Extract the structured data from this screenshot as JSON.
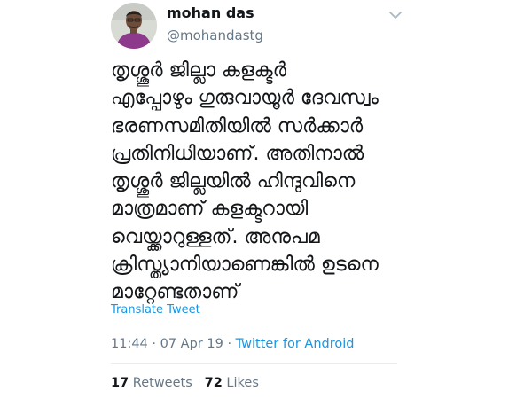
{
  "author": {
    "name": "mohan das",
    "handle": "@mohandastg"
  },
  "tweet": {
    "lines": [
      "തൃശ്ശൂർ ജില്ലാ കളക്ടർ",
      "എപ്പോഴും ഗുരുവായൂർ ദേവസ്വം",
      "ഭരണസമിതിയിൽ സർക്കാർ",
      "പ്രതിനിധിയാണ്. അതിനാൽ",
      "തൃശ്ശൂർ ജില്ലയിൽ ഹിന്ദുവിനെ",
      "മാത്രമാണ് കളക്ടറായി",
      "വെയ്ക്കാറുള്ളത്. അനുപമ",
      "ക്രിസ്ത്യാനിയാണെങ്കിൽ ഉടനെ",
      "മാറ്റേണ്ടതാണ്"
    ],
    "translate_label": "Translate Tweet"
  },
  "meta": {
    "time": "11:44",
    "separator": " · ",
    "date": "07 Apr 19",
    "source": "Twitter for Android"
  },
  "stats": {
    "retweets_count": "17",
    "retweets_label": "Retweets",
    "likes_count": "72",
    "likes_label": "Likes"
  },
  "icons": {
    "caret": "chevron-down-icon"
  },
  "colors": {
    "link": "#1b95e0",
    "secondary_text": "#657786",
    "divider": "#e6ecf0"
  }
}
